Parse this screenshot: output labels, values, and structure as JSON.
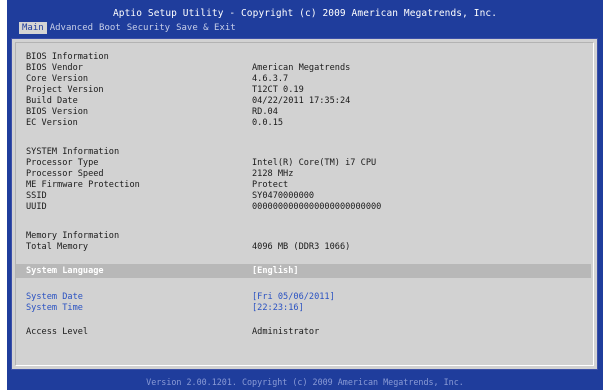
{
  "header": {
    "title": "Aptio Setup Utility - Copyright (c) 2009 American Megatrends, Inc."
  },
  "menu": {
    "tabs": [
      "Main",
      "Advanced",
      "Boot",
      "Security",
      "Save & Exit"
    ],
    "active": "Main"
  },
  "bios_info": {
    "heading": "BIOS Information",
    "bios_vendor_label": "BIOS Vendor",
    "bios_vendor": "American Megatrends",
    "core_version_label": "Core Version",
    "core_version": "4.6.3.7",
    "project_version_label": "Project Version",
    "project_version": "T12CT 0.19",
    "build_date_label": "Build Date",
    "build_date": "04/22/2011 17:35:24",
    "bios_version_label": "BIOS Version",
    "bios_version": "RD.04",
    "ec_version_label": "EC Version",
    "ec_version": "0.0.15"
  },
  "system_info": {
    "heading": "SYSTEM Information",
    "processor_type_label": "Processor Type",
    "processor_type": "Intel(R) Core(TM) i7 CPU",
    "processor_speed_label": "Processor Speed",
    "processor_speed": "2128 MHz",
    "me_fw_label": "ME Firmware Protection",
    "me_fw": "Protect",
    "ssid_label": "SSID",
    "ssid": "SY0470000000",
    "uuid_label": "UUID",
    "uuid": "0000000000000000000000000"
  },
  "memory_info": {
    "heading": "Memory Information",
    "total_memory_label": "Total Memory",
    "total_memory": "4096 MB (DDR3 1066)"
  },
  "settings": {
    "language_label": "System Language",
    "language_value": "[English]",
    "date_label": "System Date",
    "date_value": "[Fri 05/06/2011]",
    "time_label": "System Time",
    "time_value": "[22:23:16]",
    "access_label": "Access Level",
    "access_value": "Administrator"
  },
  "footer": {
    "text": "Version 2.00.1201. Copyright (c) 2009 American Megatrends, Inc."
  },
  "colors": {
    "background_blue": "#1f3d9c",
    "panel_gray": "#d2d2d2",
    "highlight_gray": "#b8b8b8",
    "selectable_blue": "#2a52c2"
  }
}
